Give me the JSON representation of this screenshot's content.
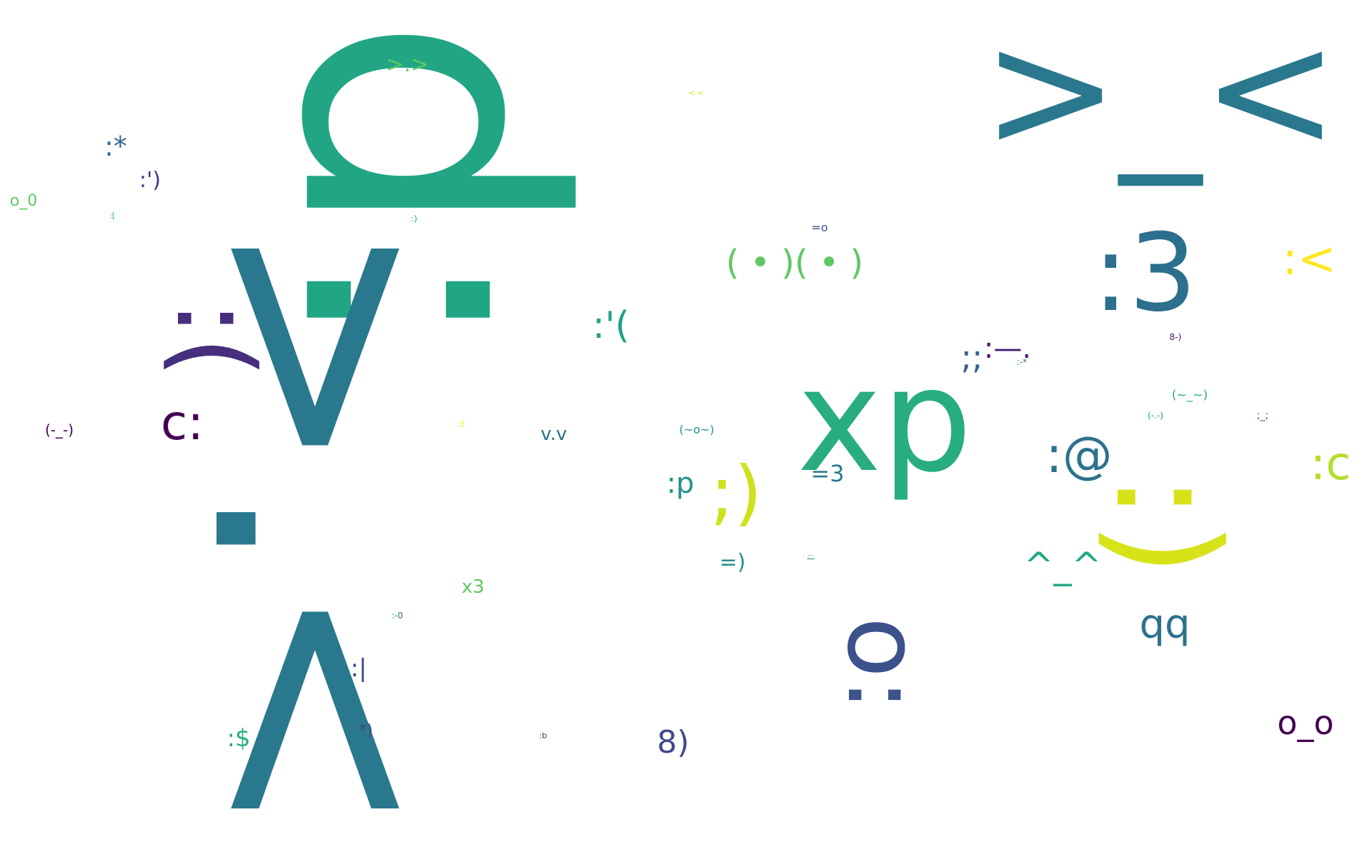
{
  "colors": {
    "purple_dark": "#440154",
    "purple": "#472d7b",
    "blue_dark": "#3b528b",
    "blue": "#2c728e",
    "teal": "#287c8e",
    "green_teal": "#21918c",
    "green": "#27ad81",
    "green_light": "#5ec962",
    "lime": "#aadc32",
    "yellow": "#fde725"
  },
  "words": [
    {
      "id": "w-d-colon",
      "text": "d:"
    },
    {
      "id": "w-gt-dot-lt",
      "text": ">.<"
    },
    {
      "id": "w-gt-underscore-lt",
      "text": ">_<"
    },
    {
      "id": "w-xp",
      "text": "xp"
    },
    {
      "id": "w-colon-3",
      "text": ":3"
    },
    {
      "id": "w-colon-paren-close",
      "text": ":)"
    },
    {
      "id": "w-colon-paren-open",
      "text": ":("
    },
    {
      "id": "w-o-dot-dot",
      "text": "o:"
    },
    {
      "id": "w-c-colon",
      "text": "c:"
    },
    {
      "id": "w-boobs",
      "text": "( • )( • )"
    },
    {
      "id": "w-colon-quote-paren-open",
      "text": ":'("
    },
    {
      "id": "w-semicolon-paren",
      "text": ";)"
    },
    {
      "id": "w-colon-at",
      "text": ":@"
    },
    {
      "id": "w-qq",
      "text": "qq"
    },
    {
      "id": "w-colon-c",
      "text": ":c"
    },
    {
      "id": "w-colon-lt",
      "text": ":<"
    },
    {
      "id": "w-caret-caret",
      "text": "^_^"
    },
    {
      "id": "w-semi-semi",
      "text": ";;"
    },
    {
      "id": "w-colon-dash-dot",
      "text": ":—."
    },
    {
      "id": "w-o-o",
      "text": "o_o"
    },
    {
      "id": "w-8-paren",
      "text": "8)"
    },
    {
      "id": "w-colon-p",
      "text": ":p"
    },
    {
      "id": "w-equals-3",
      "text": "=3"
    },
    {
      "id": "w-equals-paren",
      "text": "=)"
    },
    {
      "id": "w-colon-star",
      "text": ":*"
    },
    {
      "id": "w-colon-quote-paren-close",
      "text": ":')"
    },
    {
      "id": "w-gt-dot-gt",
      "text": ">.>"
    },
    {
      "id": "w-v-dot-v",
      "text": "v.v"
    },
    {
      "id": "w-x3",
      "text": "x3"
    },
    {
      "id": "w-colon-dollar",
      "text": ":$"
    },
    {
      "id": "w-colon-pipe",
      "text": ":|"
    },
    {
      "id": "w-star-paren",
      "text": "*)"
    },
    {
      "id": "w-o-0",
      "text": "o_0"
    },
    {
      "id": "w-sleepy",
      "text": "(-_-)"
    },
    {
      "id": "w-wave-o",
      "text": "(~o~)"
    },
    {
      "id": "w-wave-underscore",
      "text": "(~_~)"
    },
    {
      "id": "w-dash-dot-dash",
      "text": "(-.-)"
    },
    {
      "id": "w-semi-underscore-semi",
      "text": ";_;"
    },
    {
      "id": "w-equals-o",
      "text": "=o"
    },
    {
      "id": "w-8-dash-paren",
      "text": "8-)"
    },
    {
      "id": "w-colon-dash-star",
      "text": ":-*"
    },
    {
      "id": "w-colon-dash-0",
      "text": ":-0"
    },
    {
      "id": "w-lt-dot-lt",
      "text": "<.<"
    },
    {
      "id": "w-colon-bracket",
      "text": ":["
    },
    {
      "id": "w-colon-brace",
      "text": ":}"
    },
    {
      "id": "w-colon-3-small",
      "text": ":3"
    },
    {
      "id": "w-colon-b",
      "text": ":b"
    },
    {
      "id": "w-colon-bracket-close",
      "text": ":]"
    }
  ]
}
